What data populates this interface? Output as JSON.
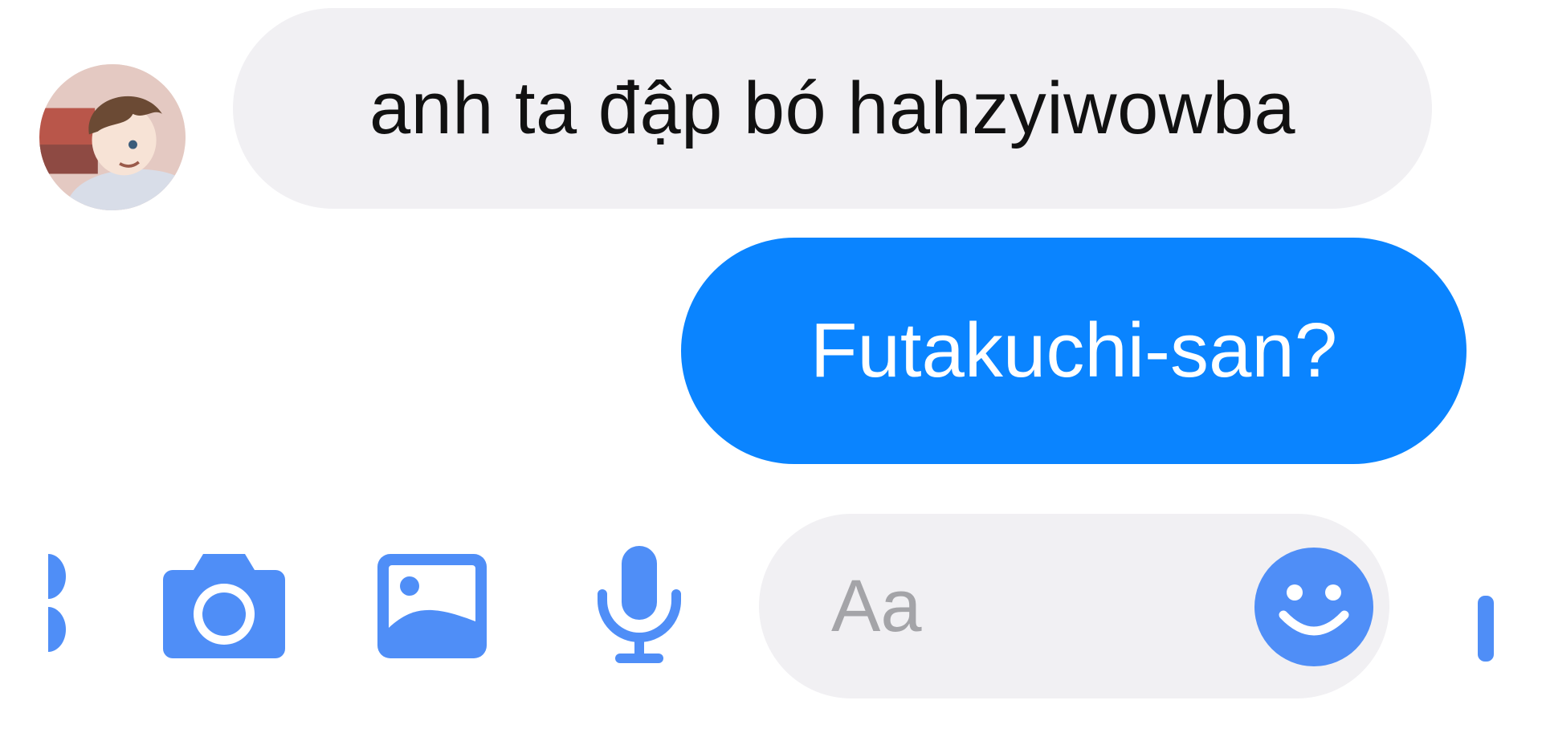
{
  "conversation": {
    "messages": [
      {
        "direction": "incoming",
        "text": "anh ta đập bó hahzyiwowba"
      },
      {
        "direction": "outgoing",
        "text": "Futakuchi-san?"
      }
    ]
  },
  "composer": {
    "placeholder": "Aa",
    "icons": [
      "more-icon",
      "camera-icon",
      "gallery-icon",
      "microphone-icon",
      "emoji-icon",
      "like-icon"
    ]
  },
  "colors": {
    "accent": "#0a84ff",
    "icon": "#4f8ef7",
    "incoming_bubble": "#f1f0f3",
    "composer_bg": "#f1f0f3",
    "placeholder_text": "#a4a4a8"
  }
}
